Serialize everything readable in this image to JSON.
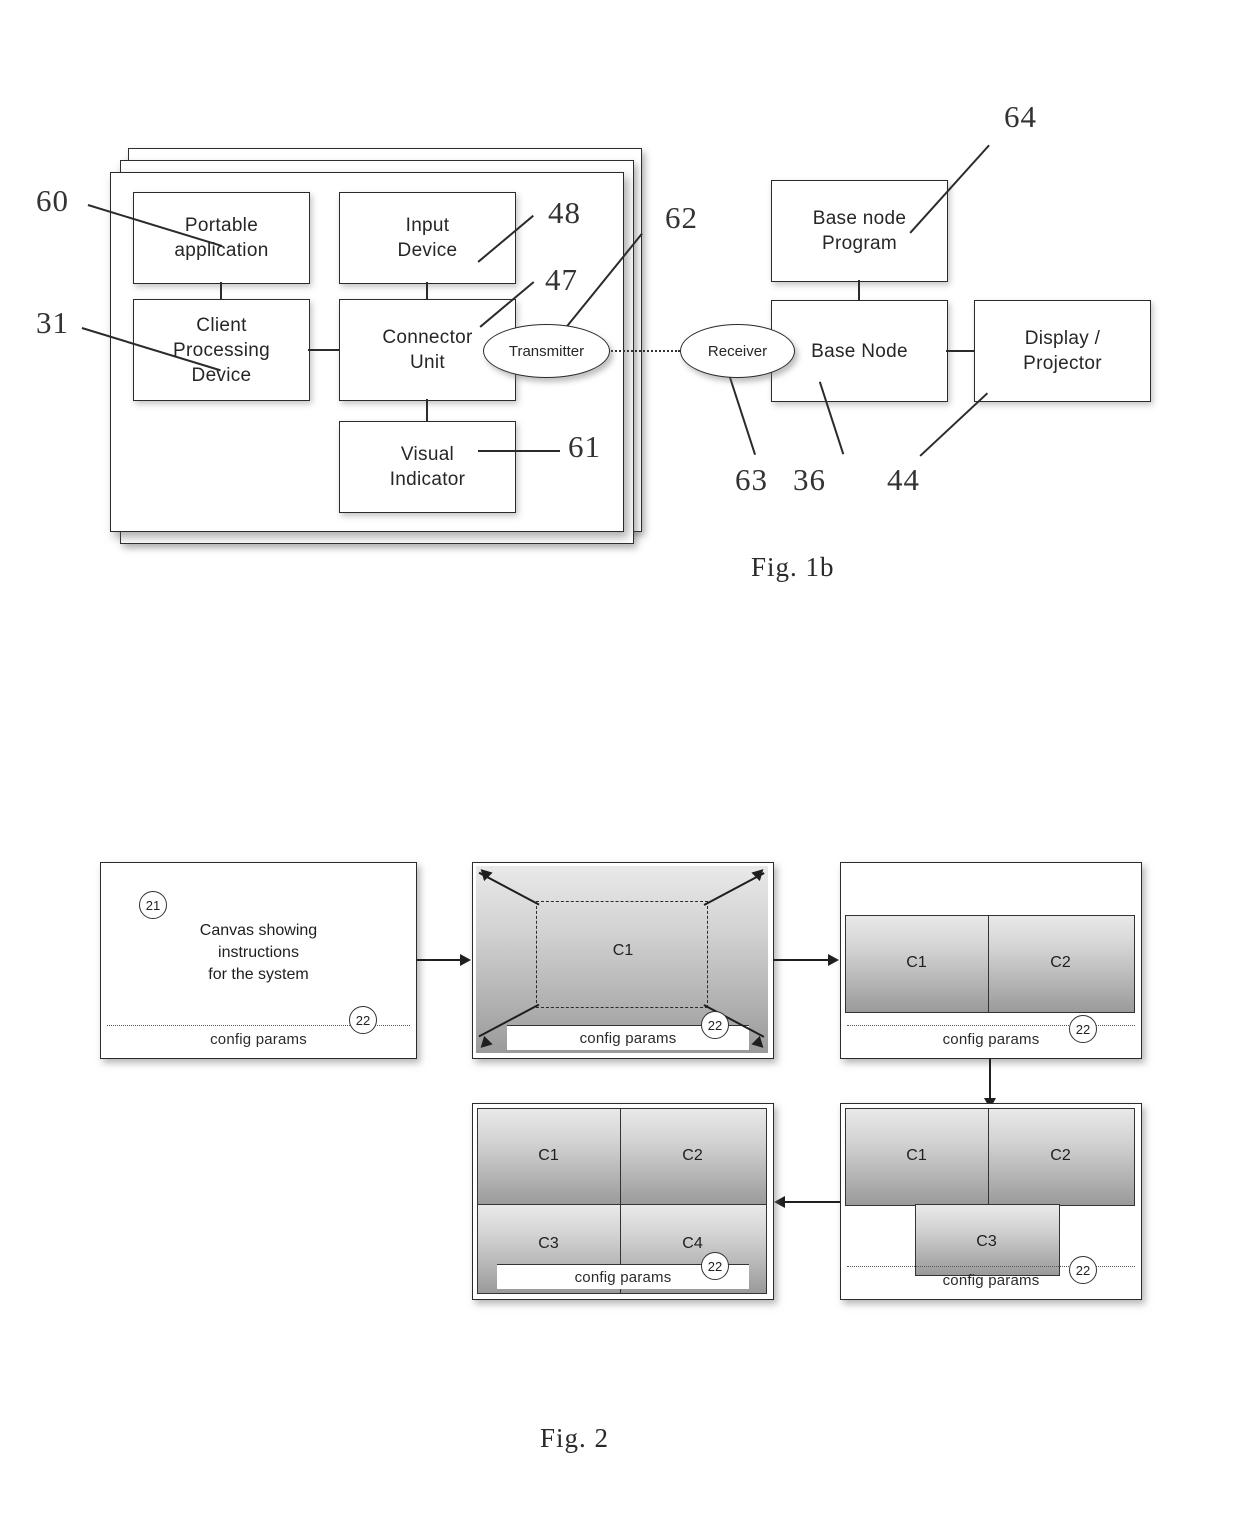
{
  "figures": {
    "fig1b": {
      "caption": "Fig. 1b",
      "client_stack": {
        "boxes": [
          {
            "id": "portable-application",
            "label": "Portable\napplication",
            "line1": "Portable",
            "line2": "application"
          },
          {
            "id": "input-device",
            "label": "Input\nDevice",
            "line1": "Input",
            "line2": "Device"
          },
          {
            "id": "client-processing-device",
            "line1": "Client",
            "line2": "Processing",
            "line3": "Device"
          },
          {
            "id": "connector-unit",
            "line1": "Connector",
            "line2": "Unit"
          },
          {
            "id": "visual-indicator",
            "line1": "Visual",
            "line2": "Indicator"
          }
        ],
        "transmitter": "Transmitter"
      },
      "base_side": {
        "receiver": "Receiver",
        "base_node_program_line1": "Base node",
        "base_node_program_line2": "Program",
        "base_node": "Base Node",
        "display_line1": "Display /",
        "display_line2": "Projector"
      },
      "refs": {
        "r60": "60",
        "r31": "31",
        "r48": "48",
        "r47": "47",
        "r61": "61",
        "r62": "62",
        "r63": "63",
        "r36": "36",
        "r44": "44",
        "r64": "64"
      }
    },
    "fig2": {
      "caption": "Fig. 2",
      "config_params_label": "config params",
      "badge_canvas": "21",
      "badge_config": "22",
      "panels": [
        {
          "id": "panel-instructions",
          "title_line1": "Canvas showing",
          "title_line2": "instructions",
          "title_line3": "for the system",
          "cells": []
        },
        {
          "id": "panel-single-canvas",
          "cells": [
            {
              "name": "C1"
            }
          ]
        },
        {
          "id": "panel-two-canvas",
          "cells": [
            {
              "name": "C1"
            },
            {
              "name": "C2"
            }
          ]
        },
        {
          "id": "panel-three-canvas",
          "cells": [
            {
              "name": "C1"
            },
            {
              "name": "C2"
            },
            {
              "name": "C3"
            }
          ]
        },
        {
          "id": "panel-four-canvas",
          "cells": [
            {
              "name": "C1"
            },
            {
              "name": "C2"
            },
            {
              "name": "C3"
            },
            {
              "name": "C4"
            }
          ]
        }
      ]
    }
  },
  "colors": {
    "ink": "#2b2b2b",
    "page": "#ffffff",
    "cell_gradient_top": "#e9e9e9",
    "cell_gradient_bottom": "#9a9a9a"
  }
}
